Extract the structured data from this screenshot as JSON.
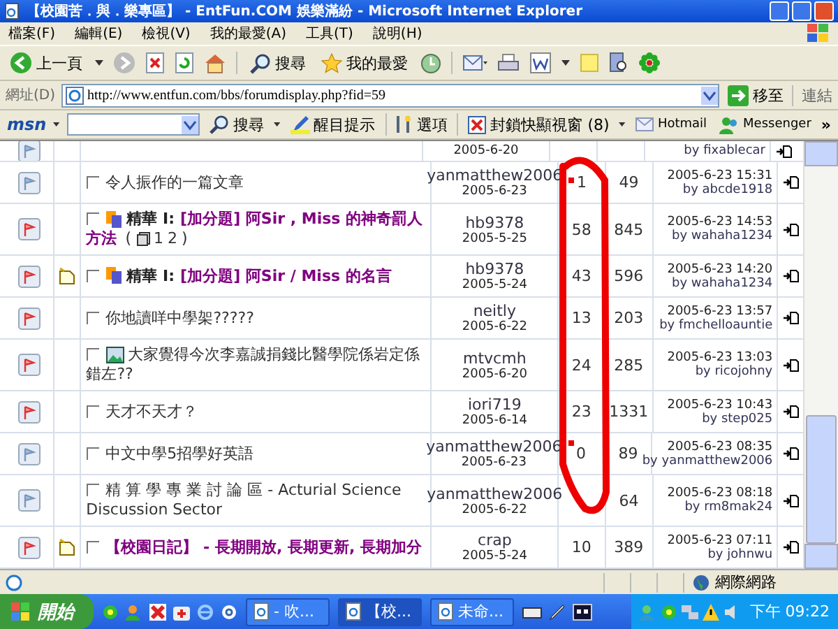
{
  "window": {
    "title": "【校園苦．與．樂專區】 - EntFun.COM 娛樂滿紛 - Microsoft Internet Explorer"
  },
  "menu": [
    "檔案(F)",
    "編輯(E)",
    "檢視(V)",
    "我的最愛(A)",
    "工具(T)",
    "說明(H)"
  ],
  "toolbar": {
    "back": "上一頁",
    "search": "搜尋",
    "favorites": "我的最愛"
  },
  "address": {
    "label": "網址(D)",
    "url": "http://www.entfun.com/bbs/forumdisplay.php?fid=59",
    "go": "移至",
    "links": "連結"
  },
  "msn_bar": {
    "logo": "msn",
    "search": "搜尋",
    "highlight": "醒目提示",
    "options": "選項",
    "popup_blocker": "封鎖快顯視窗 (8)",
    "hotmail": "Hotmail",
    "messenger": "Messenger",
    "more": "»"
  },
  "threads": [
    {
      "kind": "partial",
      "hot": false,
      "date": "2005-6-20",
      "last_by": "by fixablecar"
    },
    {
      "kind": "thread",
      "hot": false,
      "new": false,
      "checked": false,
      "title": "令人振作的一篇文章",
      "highlighted": false,
      "image": false,
      "author": "yanmatthew2006",
      "date": "2005-6-23",
      "replies": "1",
      "views": "49",
      "last_time": "2005-6-23 15:31",
      "last_by": "by abcde1918"
    },
    {
      "kind": "thread",
      "hot": true,
      "new": false,
      "checked": false,
      "prefix": "精華 I:",
      "title": "[加分題] 阿Sir , Miss 的神奇罰人方法",
      "highlighted": true,
      "image": false,
      "pages": {
        "before": "(",
        "links": [
          "1",
          "2"
        ],
        "after": ")"
      },
      "author": "hb9378",
      "date": "2005-5-25",
      "replies": "58",
      "views": "845",
      "last_time": "2005-6-23 14:53",
      "last_by": "by wahaha1234"
    },
    {
      "kind": "thread",
      "hot": true,
      "new": true,
      "checked": false,
      "prefix": "精華 I:",
      "title": "[加分題] 阿Sir / Miss 的名言",
      "highlighted": true,
      "image": false,
      "author": "hb9378",
      "date": "2005-5-24",
      "replies": "43",
      "views": "596",
      "last_time": "2005-6-23 14:20",
      "last_by": "by wahaha1234"
    },
    {
      "kind": "thread",
      "hot": true,
      "new": false,
      "checked": false,
      "title": "你地讀咩中學架?????",
      "highlighted": false,
      "image": false,
      "author": "neitly",
      "date": "2005-6-22",
      "replies": "13",
      "views": "203",
      "last_time": "2005-6-23 13:57",
      "last_by": "by fmchelloauntie"
    },
    {
      "kind": "thread",
      "hot": true,
      "new": false,
      "checked": false,
      "title": "大家覺得今次李嘉誠捐錢比醫學院係岩定係錯左??",
      "highlighted": false,
      "image": true,
      "author": "mtvcmh",
      "date": "2005-6-20",
      "replies": "24",
      "views": "285",
      "last_time": "2005-6-23 13:03",
      "last_by": "by ricojohny"
    },
    {
      "kind": "thread",
      "hot": true,
      "new": false,
      "checked": false,
      "title": "天才不天才？",
      "highlighted": false,
      "image": false,
      "author": "iori719",
      "date": "2005-6-14",
      "replies": "23",
      "views": "1331",
      "last_time": "2005-6-23 10:43",
      "last_by": "by step025"
    },
    {
      "kind": "thread",
      "hot": false,
      "new": false,
      "checked": false,
      "title": "中文中學5招學好英語",
      "highlighted": false,
      "image": false,
      "author": "yanmatthew2006",
      "date": "2005-6-23",
      "replies": "0",
      "views": "89",
      "last_time": "2005-6-23 08:35",
      "last_by": "by yanmatthew2006"
    },
    {
      "kind": "thread",
      "hot": false,
      "new": false,
      "checked": false,
      "title": "精 算 學 專 業 討 論 區 - Acturial Science Discussion Sector",
      "highlighted": false,
      "image": false,
      "author": "yanmatthew2006",
      "date": "2005-6-22",
      "views": "64",
      "last_time": "2005-6-23 08:18",
      "last_by": "by rm8mak24"
    },
    {
      "kind": "thread",
      "hot": true,
      "new": true,
      "checked": false,
      "title": "【校園日記】 - 長期開放, 長期更新, 長期加分",
      "highlighted": true,
      "image": false,
      "author": "crap",
      "date": "2005-5-24",
      "replies": "10",
      "views": "389",
      "last_time": "2005-6-23 07:11",
      "last_by": "by johnwu"
    }
  ],
  "status_bar": {
    "zone": "網際網路"
  },
  "taskbar": {
    "start": "開始",
    "tasks": [
      {
        "label": "- 吹...",
        "selected": false
      },
      {
        "label": "【校...",
        "selected": true
      },
      {
        "label": "未命...",
        "selected": false
      }
    ],
    "clock": "下午 09:22"
  }
}
